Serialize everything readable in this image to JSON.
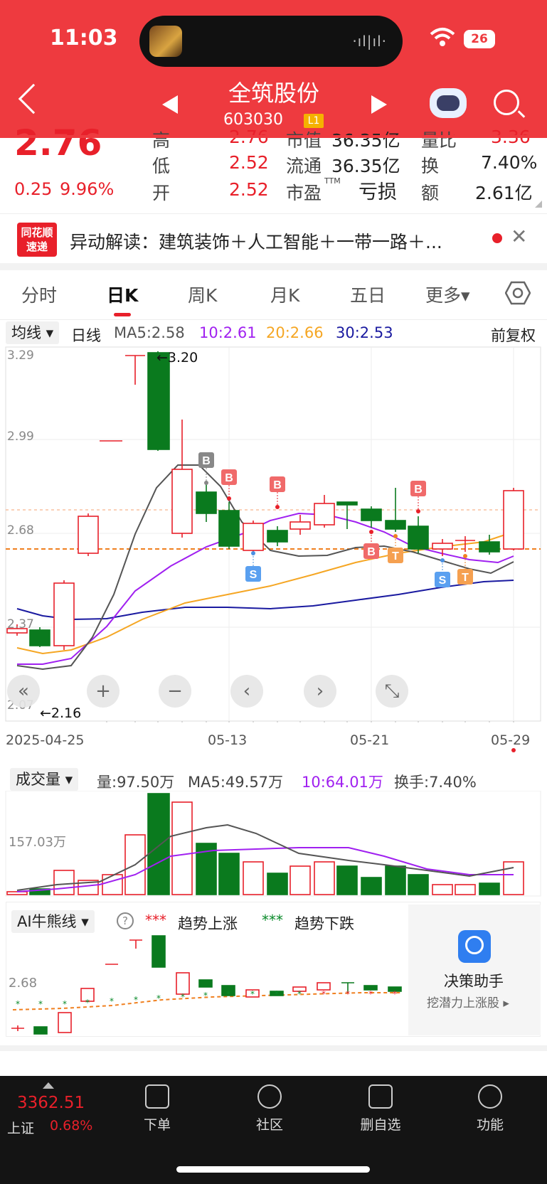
{
  "status_bar": {
    "time": "11:03",
    "battery": "26",
    "wave": "·ıl|ıl·"
  },
  "header": {
    "stock_name": "全筑股份",
    "stock_code": "603030",
    "level": "L1"
  },
  "quote": {
    "price": "2.76",
    "change": "0.25",
    "change_pct": "9.96%",
    "high_label": "高",
    "high": "2.76",
    "low_label": "低",
    "low": "2.52",
    "open_label": "开",
    "open": "2.52",
    "mktcap_label": "市值",
    "mktcap": "36.35亿",
    "float_label": "流通",
    "float_cap": "36.35亿",
    "pe_label": "市盈",
    "pe_sup": "TTM",
    "pe": "亏损",
    "volratio_label": "量比",
    "volratio": "3.36",
    "turnover_label": "换",
    "turnover": "7.40%",
    "amount_label": "额",
    "amount": "2.61亿"
  },
  "news": {
    "logo_line1": "同花顺",
    "logo_line2": "速递",
    "text": "异动解读：建筑装饰＋人工智能＋一带一路＋..."
  },
  "tabs": [
    "分时",
    "日K",
    "周K",
    "月K",
    "五日",
    "更多▾"
  ],
  "kline": {
    "mode": "均线 ▾",
    "period": "日线",
    "ma5": "MA5:2.58",
    "ma10": "10:2.61",
    "ma20": "20:2.66",
    "ma30": "30:2.53",
    "adjust": "前复权",
    "y_ticks": [
      "3.29",
      "2.99",
      "2.68",
      "2.37",
      "2.07"
    ],
    "high_mark": "←3.20",
    "low_mark": "←2.16",
    "x_ticks": [
      "2025-04-25",
      "05-13",
      "05-21",
      "05-29"
    ],
    "colors": {
      "up": "#e8202a",
      "down": "#0a7a1e",
      "ma5": "#555555",
      "ma10": "#a020f0",
      "ma20": "#f5a623",
      "ma30": "#1a1aa0"
    }
  },
  "controls": [
    "«",
    "+",
    "−",
    "‹",
    "›",
    "⤡"
  ],
  "signals": {
    "b": "B",
    "s": "S",
    "t": "T"
  },
  "volume": {
    "label": "成交量 ▾",
    "vol": "量:97.50万",
    "ma5": "MA5:49.57万",
    "ma10": "10:64.01万",
    "turnover": "换手:7.40%",
    "y_tick": "157.03万"
  },
  "ai": {
    "label": "AI牛熊线 ▾",
    "help": "?",
    "up_legend": "趋势上涨",
    "down_legend": "趋势下跌",
    "y_tick": "2.68",
    "assistant_title": "决策助手",
    "assistant_sub": "挖潜力上涨股 ▸"
  },
  "bottom_nav": {
    "index_value": "3362.51",
    "index_name": "上证",
    "index_pct": "0.68%",
    "items": [
      "下单",
      "社区",
      "删自选",
      "功能"
    ]
  }
}
